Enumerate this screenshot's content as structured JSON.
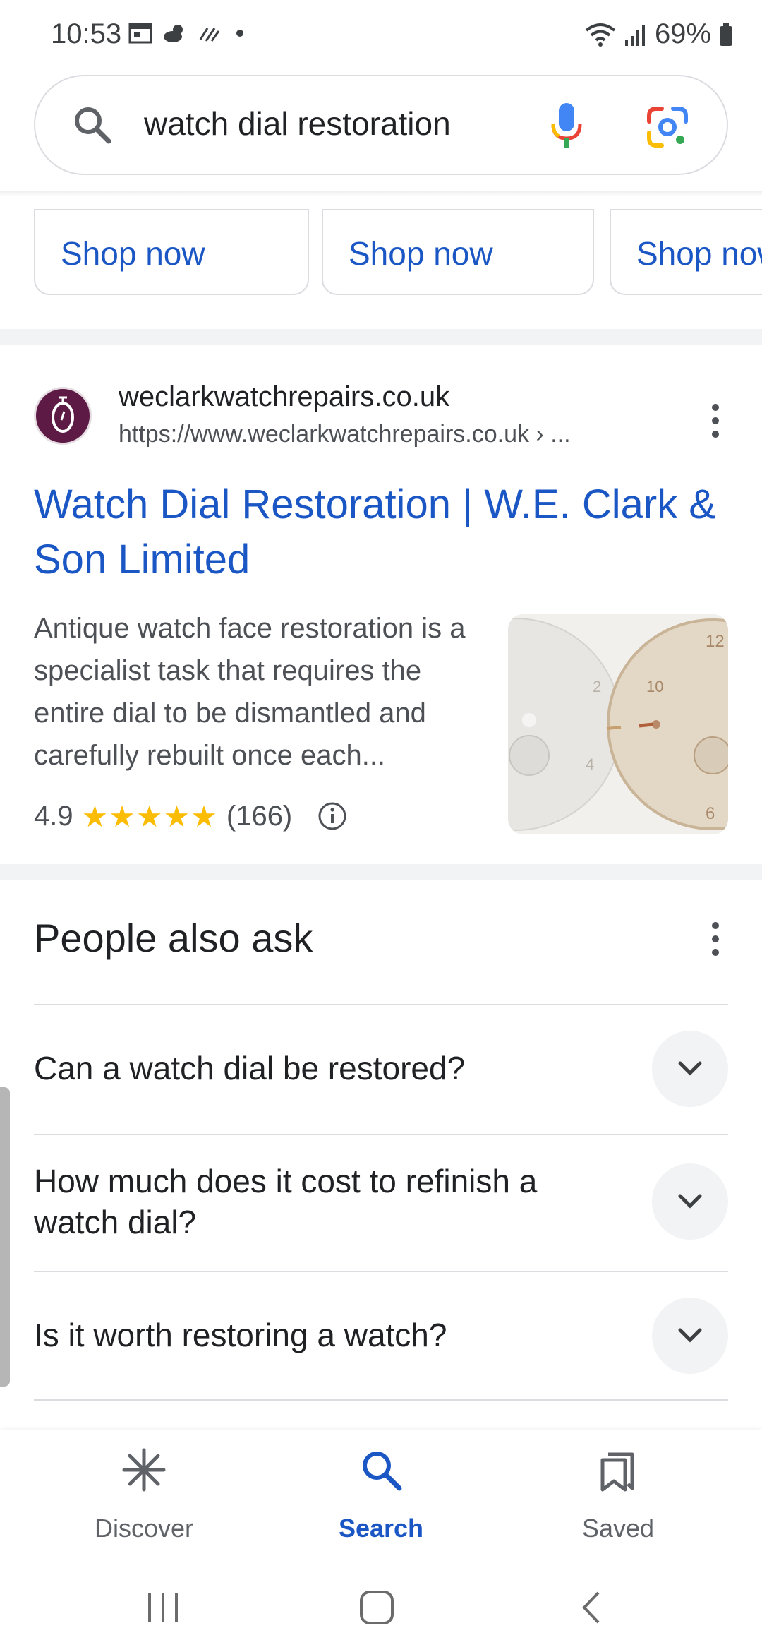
{
  "status_bar": {
    "time": "10:53",
    "battery": "69%"
  },
  "search": {
    "query": "watch dial restoration"
  },
  "shop_cards": [
    {
      "label": "Shop now"
    },
    {
      "label": "Shop now"
    },
    {
      "label": "Shop now"
    }
  ],
  "result": {
    "site_name": "weclarkwatchrepairs.co.uk",
    "url": "https://www.weclarkwatchrepairs.co.uk › ...",
    "title": "Watch Dial Restoration | W.E. Clark & Son Limited",
    "snippet": "Antique watch face restoration is a specialist task that requires the entire dial to be dismantled and carefully rebuilt once each...",
    "rating": "4.9",
    "stars": "★★★★★",
    "review_count": "(166)"
  },
  "people_also_ask": {
    "heading": "People also ask",
    "questions": [
      "Can a watch dial be restored?",
      "How much does it cost to refinish a watch dial?",
      "Is it worth restoring a watch?"
    ]
  },
  "bottom_nav": {
    "items": [
      {
        "label": "Discover",
        "icon": "asterisk-icon"
      },
      {
        "label": "Search",
        "icon": "search-icon",
        "active": true
      },
      {
        "label": "Saved",
        "icon": "bookmarks-icon"
      }
    ]
  },
  "colors": {
    "link_blue": "#1a56c4",
    "star_yellow": "#fbbc04",
    "logo_purple": "#5c1a45"
  }
}
